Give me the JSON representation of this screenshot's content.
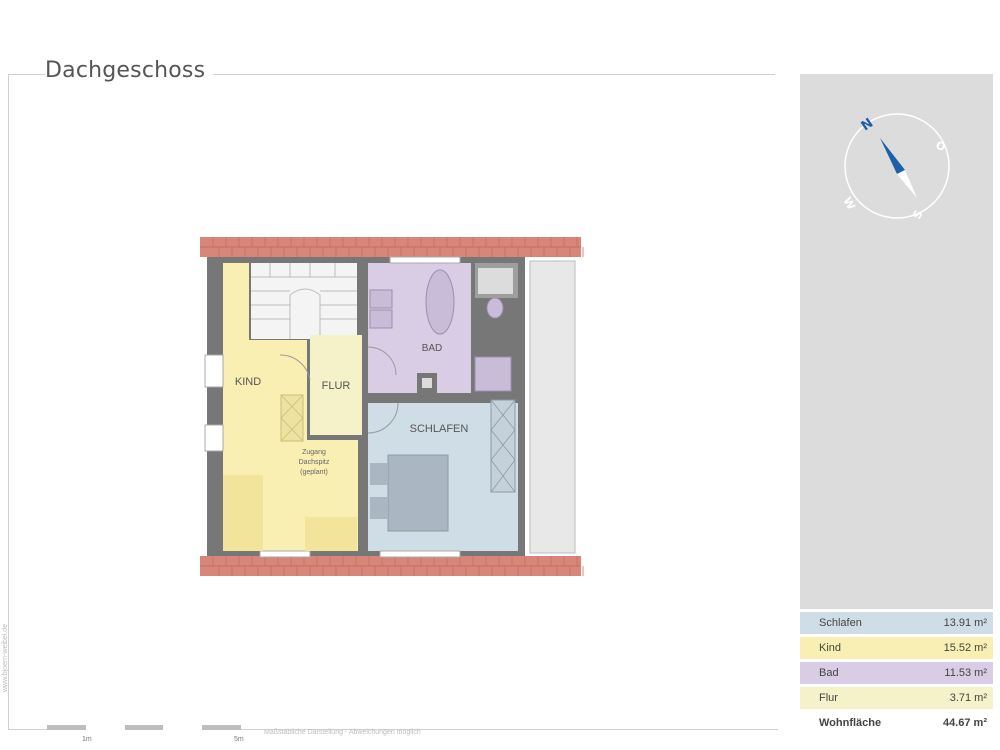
{
  "title": "Dachgeschoss",
  "colors": {
    "schlafen": "#cfdde6",
    "kind": "#f9efb2",
    "bad": "#d8cde4",
    "flur": "#f5f1c8",
    "wall": "#777777",
    "roof": "#d9867a",
    "panel": "#dcdcdc",
    "compass_blue": "#1f5ea8"
  },
  "compass": {
    "n": "N",
    "o": "O",
    "s": "S",
    "w": "W"
  },
  "rooms": {
    "kind": "KIND",
    "flur": "FLUR",
    "bad": "BAD",
    "schlafen": "SCHLAFEN",
    "zugang_line1": "Zugang",
    "zugang_line2": "Dachspitz",
    "zugang_line3": "(geplant)"
  },
  "legend": [
    {
      "name": "Schlafen",
      "area": "13.91 m²",
      "color": "#cfdde6"
    },
    {
      "name": "Kind",
      "area": "15.52 m²",
      "color": "#f9efb2"
    },
    {
      "name": "Bad",
      "area": "11.53 m²",
      "color": "#d8cde4"
    },
    {
      "name": "Flur",
      "area": "3.71 m²",
      "color": "#f5f1c8"
    }
  ],
  "total": {
    "name": "Wohnfläche",
    "area": "44.67 m²"
  },
  "scale": {
    "label_start": "1m",
    "label_end": "5m"
  },
  "disclaimer": "Maßstäbliche Darstellung - Abweichungen möglich",
  "watermark": "www.bjoern-weibel.de"
}
